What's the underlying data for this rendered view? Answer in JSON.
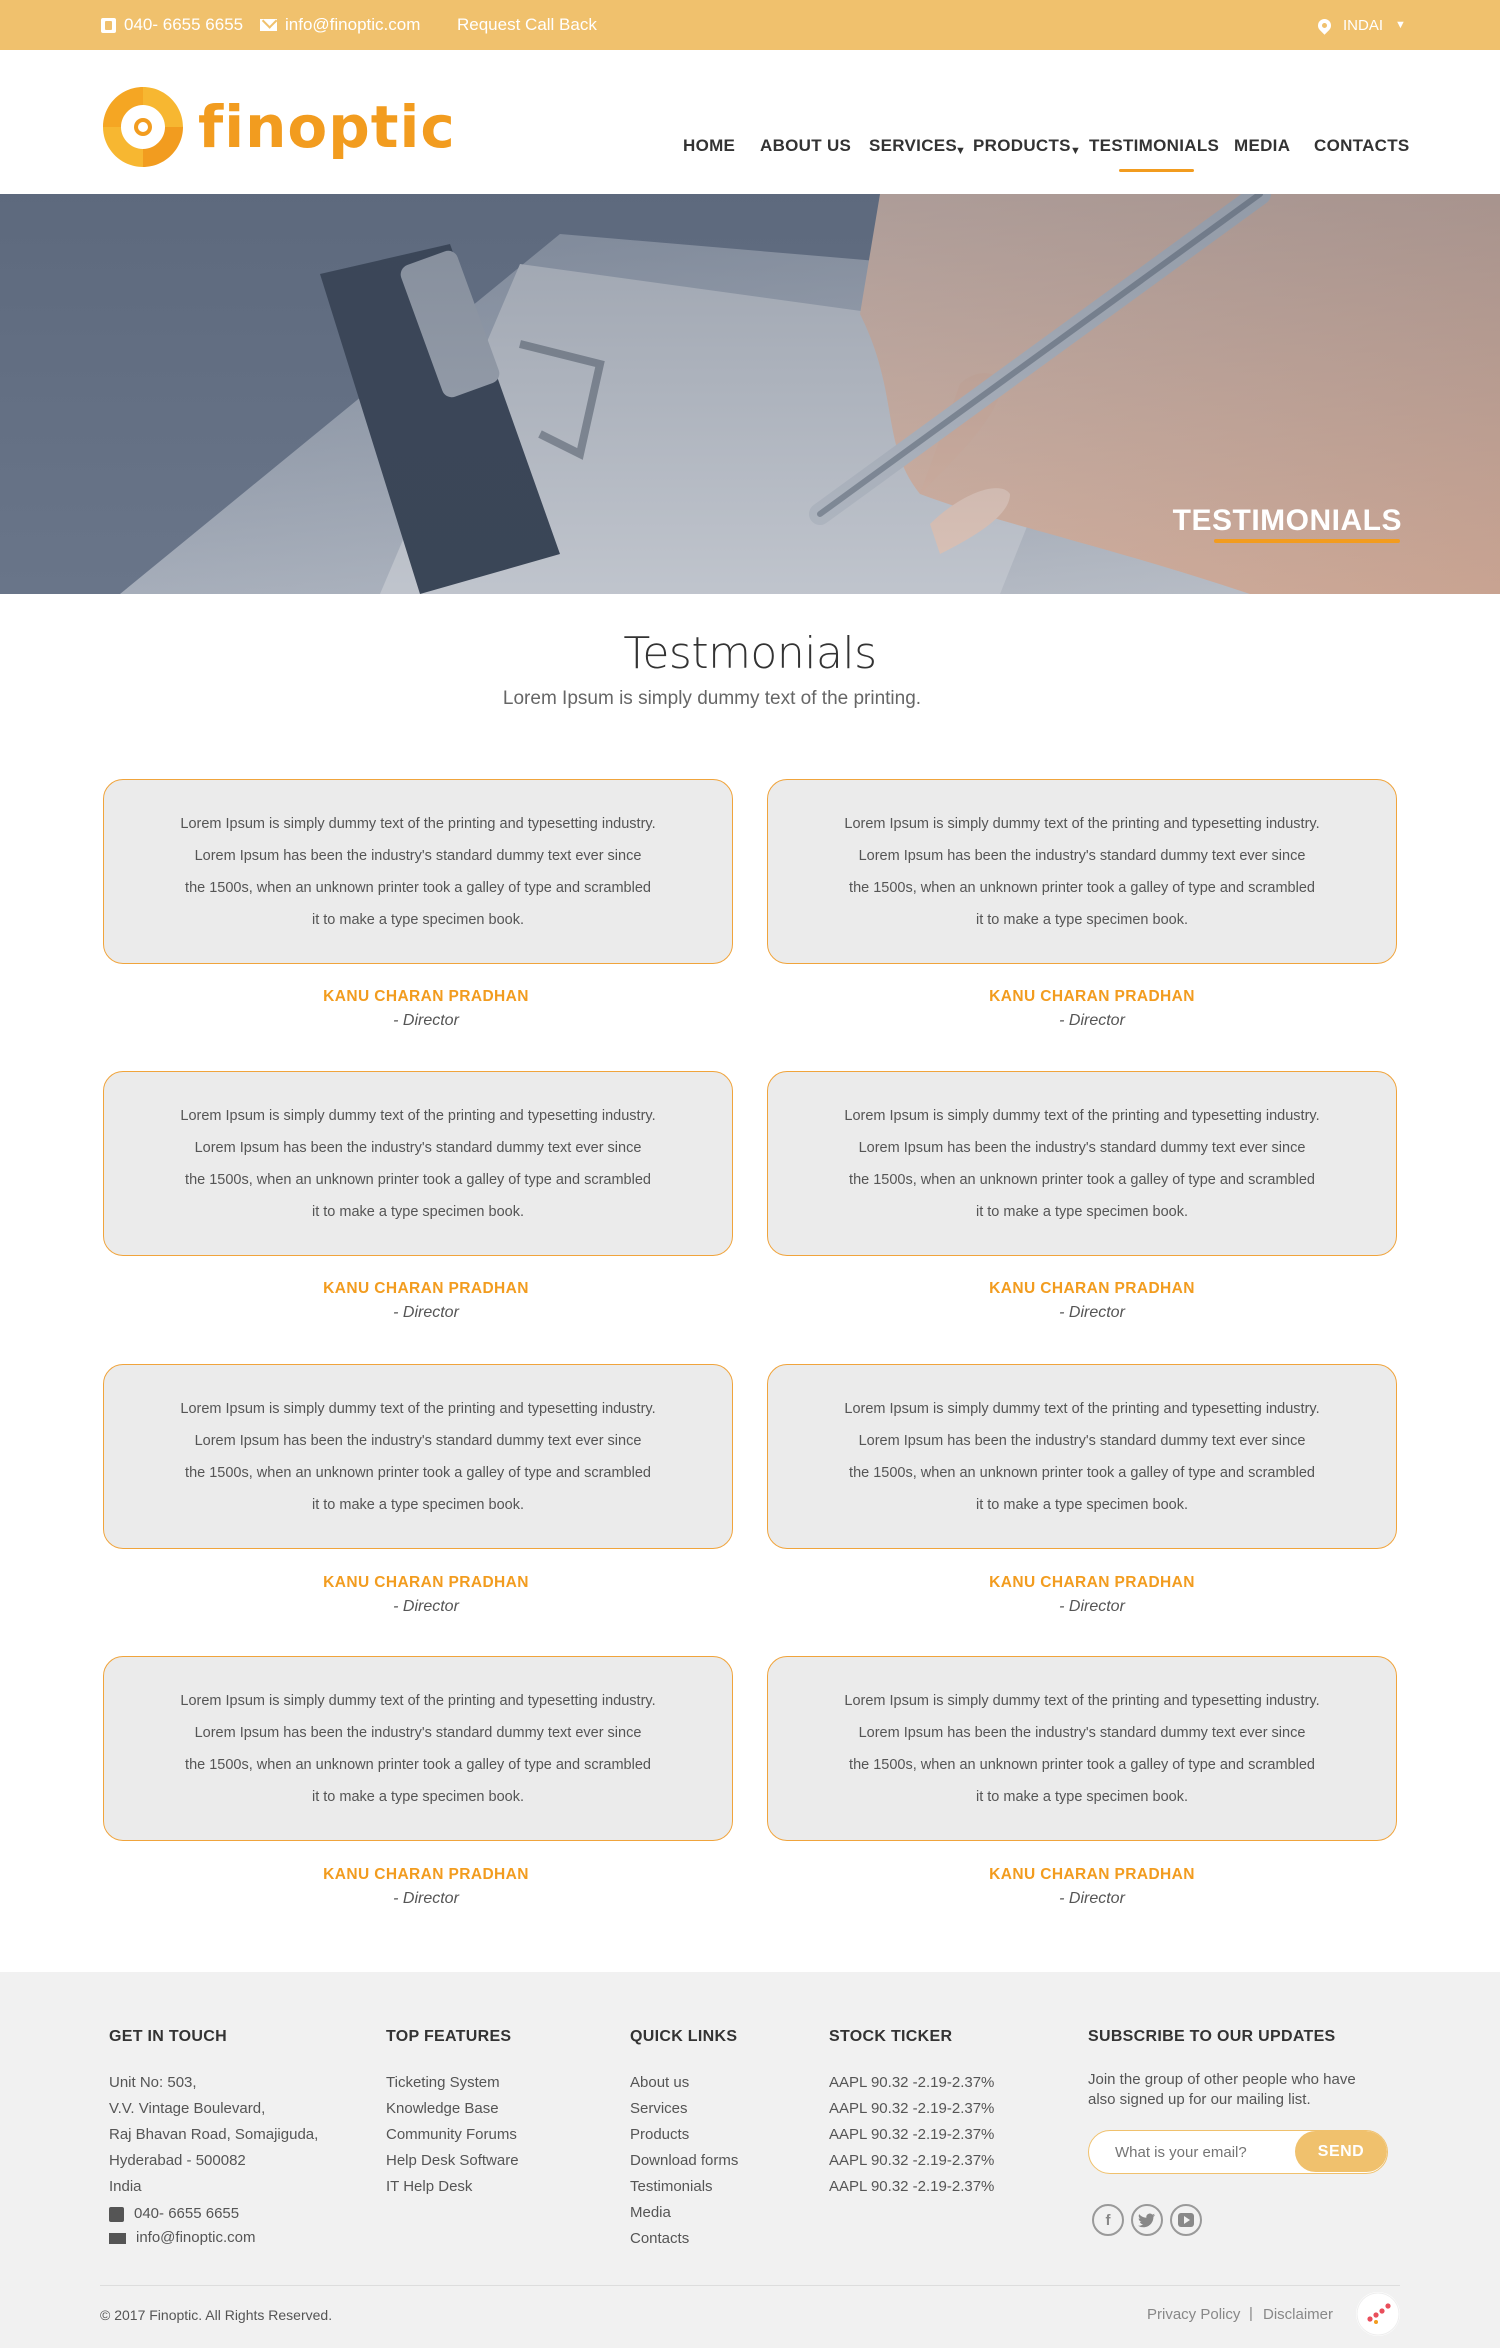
{
  "topbar": {
    "phone": "040- 6655 6655",
    "email": "info@finoptic.com",
    "callback": "Request Call Back",
    "location": "INDAI"
  },
  "brand": {
    "name": "finoptic",
    "color": "#f29c1f"
  },
  "nav": {
    "items": [
      "HOME",
      "ABOUT US",
      "SERVICES",
      "PRODUCTS",
      "TESTIMONIALS",
      "MEDIA",
      "CONTACTS"
    ],
    "active": "TESTIMONIALS"
  },
  "hero": {
    "title": "TESTIMONIALS"
  },
  "section": {
    "title": "Testmonials",
    "subtitle": "Lorem Ipsum is simply dummy text of the printing."
  },
  "testimonials": [
    {
      "line1": "Lorem Ipsum is simply dummy text of the printing and typesetting industry.",
      "line2": "Lorem Ipsum has been the industry's standard dummy text ever since",
      "line3": "the 1500s, when an unknown printer took a galley of type and scrambled",
      "line4": "it to make a type specimen book.",
      "name": "KANU CHARAN PRADHAN",
      "role": "- Director"
    },
    {
      "line1": "Lorem Ipsum is simply dummy text of the printing and typesetting industry.",
      "line2": "Lorem Ipsum has been the industry's standard dummy text ever since",
      "line3": "the 1500s, when an unknown printer took a galley of type and scrambled",
      "line4": "it to make a type specimen book.",
      "name": "KANU CHARAN PRADHAN",
      "role": "- Director"
    },
    {
      "line1": "Lorem Ipsum is simply dummy text of the printing and typesetting industry.",
      "line2": "Lorem Ipsum has been the industry's standard dummy text ever since",
      "line3": "the 1500s, when an unknown printer took a galley of type and scrambled",
      "line4": "it to make a type specimen book.",
      "name": "KANU CHARAN PRADHAN",
      "role": "- Director"
    },
    {
      "line1": "Lorem Ipsum is simply dummy text of the printing and typesetting industry.",
      "line2": "Lorem Ipsum has been the industry's standard dummy text ever since",
      "line3": "the 1500s, when an unknown printer took a galley of type and scrambled",
      "line4": "it to make a type specimen book.",
      "name": "KANU CHARAN PRADHAN",
      "role": "- Director"
    },
    {
      "line1": "Lorem Ipsum is simply dummy text of the printing and typesetting industry.",
      "line2": "Lorem Ipsum has been the industry's standard dummy text ever since",
      "line3": "the 1500s, when an unknown printer took a galley of type and scrambled",
      "line4": "it to make a type specimen book.",
      "name": "KANU CHARAN PRADHAN",
      "role": "- Director"
    },
    {
      "line1": "Lorem Ipsum is simply dummy text of the printing and typesetting industry.",
      "line2": "Lorem Ipsum has been the industry's standard dummy text ever since",
      "line3": "the 1500s, when an unknown printer took a galley of type and scrambled",
      "line4": "it to make a type specimen book.",
      "name": "KANU CHARAN PRADHAN",
      "role": "- Director"
    },
    {
      "line1": "Lorem Ipsum is simply dummy text of the printing and typesetting industry.",
      "line2": "Lorem Ipsum has been the industry's standard dummy text ever since",
      "line3": "the 1500s, when an unknown printer took a galley of type and scrambled",
      "line4": "it to make a type specimen book.",
      "name": "KANU CHARAN PRADHAN",
      "role": "- Director"
    },
    {
      "line1": "Lorem Ipsum is simply dummy text of the printing and typesetting industry.",
      "line2": "Lorem Ipsum has been the industry's standard dummy text ever since",
      "line3": "the 1500s, when an unknown printer took a galley of type and scrambled",
      "line4": "it to make a type specimen book.",
      "name": "KANU CHARAN PRADHAN",
      "role": "- Director"
    }
  ],
  "footer": {
    "get_in_touch": {
      "heading": "GET IN TOUCH",
      "address": [
        "Unit No: 503,",
        "V.V. Vintage Boulevard,",
        "Raj Bhavan Road, Somajiguda,",
        "Hyderabad - 500082",
        "India"
      ],
      "phone": "040- 6655 6655",
      "email": "info@finoptic.com"
    },
    "top_features": {
      "heading": "TOP FEATURES",
      "items": [
        "Ticketing System",
        "Knowledge Base",
        "Community Forums",
        "Help Desk Software",
        "IT Help Desk"
      ]
    },
    "quick_links": {
      "heading": "QUICK LINKS",
      "items": [
        "About us",
        "Services",
        "Products",
        "Download forms",
        "Testimonials",
        "Media",
        "Contacts"
      ]
    },
    "stock_ticker": {
      "heading": "STOCK TICKER",
      "items": [
        "AAPL 90.32 -2.19-2.37%",
        "AAPL 90.32 -2.19-2.37%",
        "AAPL 90.32 -2.19-2.37%",
        "AAPL 90.32 -2.19-2.37%",
        "AAPL 90.32 -2.19-2.37%"
      ]
    },
    "subscribe": {
      "heading": "SUBSCRIBE TO OUR UPDATES",
      "text1": "Join the group of other people who have",
      "text2": "also signed up for our mailing list.",
      "placeholder": "What is your email?",
      "button": "SEND"
    },
    "social": [
      "facebook-icon",
      "twitter-icon",
      "youtube-icon"
    ],
    "copyright": "© 2017 Finoptic. All Rights Reserved.",
    "privacy": "Privacy Policy",
    "separator": "|",
    "disclaimer": "Disclaimer"
  },
  "colors": {
    "topbar": "#f0c16d",
    "accent": "#f29c1f",
    "card_bg": "#ebebeb",
    "footer_bg": "#f1f1f1"
  }
}
